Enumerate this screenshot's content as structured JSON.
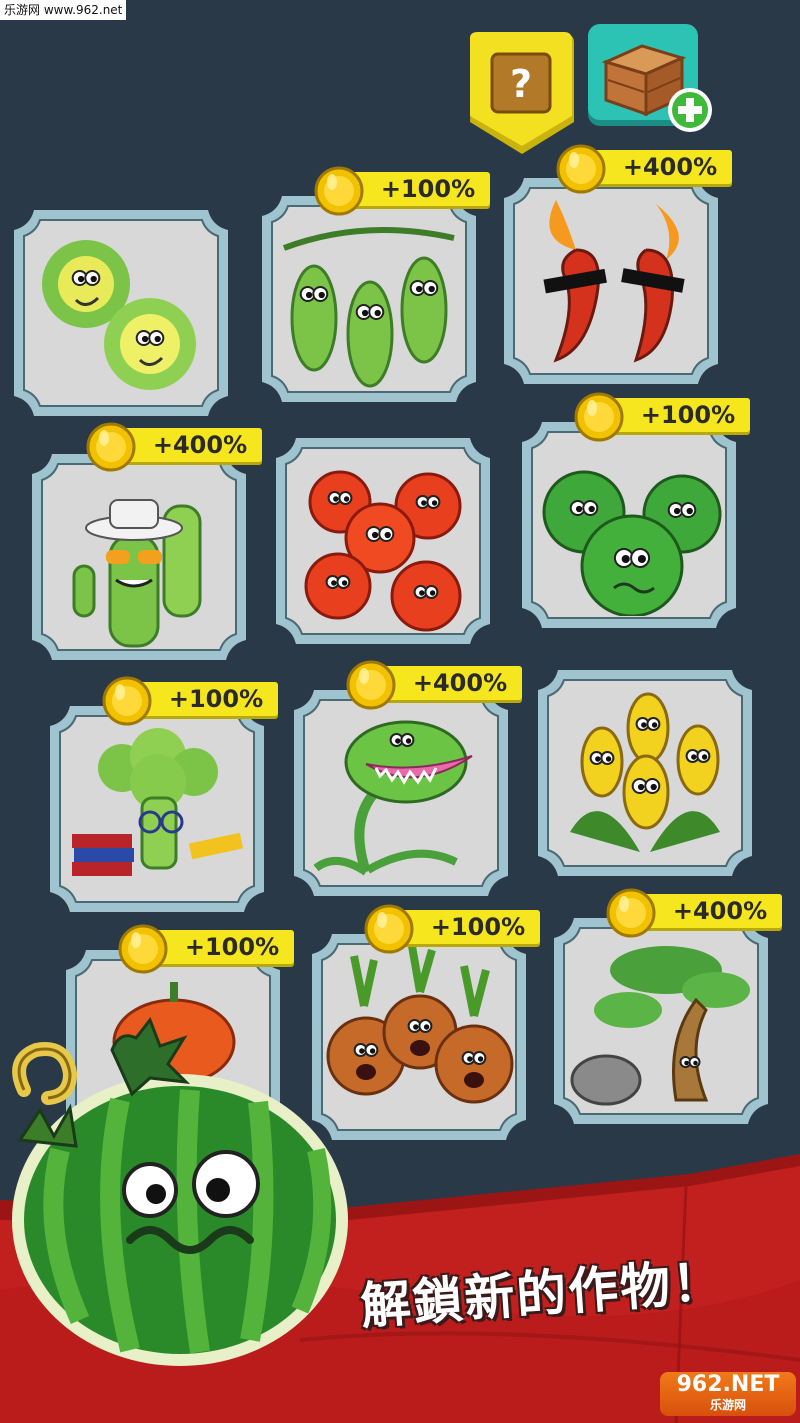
{
  "watermark_top": "乐游网 www.962.net",
  "top_buttons": {
    "help_glyph": "?",
    "help_icon": "question-mark-icon",
    "shop_icon": "crate-icon",
    "shop_plus_icon": "plus-icon"
  },
  "crops": [
    {
      "name": "lettuce",
      "bonus": ""
    },
    {
      "name": "peas",
      "bonus": "+100%"
    },
    {
      "name": "chili-peppers",
      "bonus": "+400%"
    },
    {
      "name": "cactus",
      "bonus": "+400%"
    },
    {
      "name": "tomatoes",
      "bonus": ""
    },
    {
      "name": "watermelons",
      "bonus": "+100%"
    },
    {
      "name": "broccoli",
      "bonus": "+100%"
    },
    {
      "name": "venus-flytrap",
      "bonus": "+400%"
    },
    {
      "name": "corn",
      "bonus": ""
    },
    {
      "name": "pumpkin",
      "bonus": "+100%"
    },
    {
      "name": "onions",
      "bonus": "+100%"
    },
    {
      "name": "bonsai-tree",
      "bonus": "+400%"
    }
  ],
  "banner": {
    "text": "解鎖新的作物！"
  },
  "watermark_bottom": {
    "main": "962.NET",
    "sub": "乐游网"
  },
  "colors": {
    "background": "#293947",
    "card_fill": "#dcdcdc",
    "card_border": "#9fc3cf",
    "badge": "#f5e61e",
    "coin": "#f2c200",
    "banner": "#c2201e"
  }
}
